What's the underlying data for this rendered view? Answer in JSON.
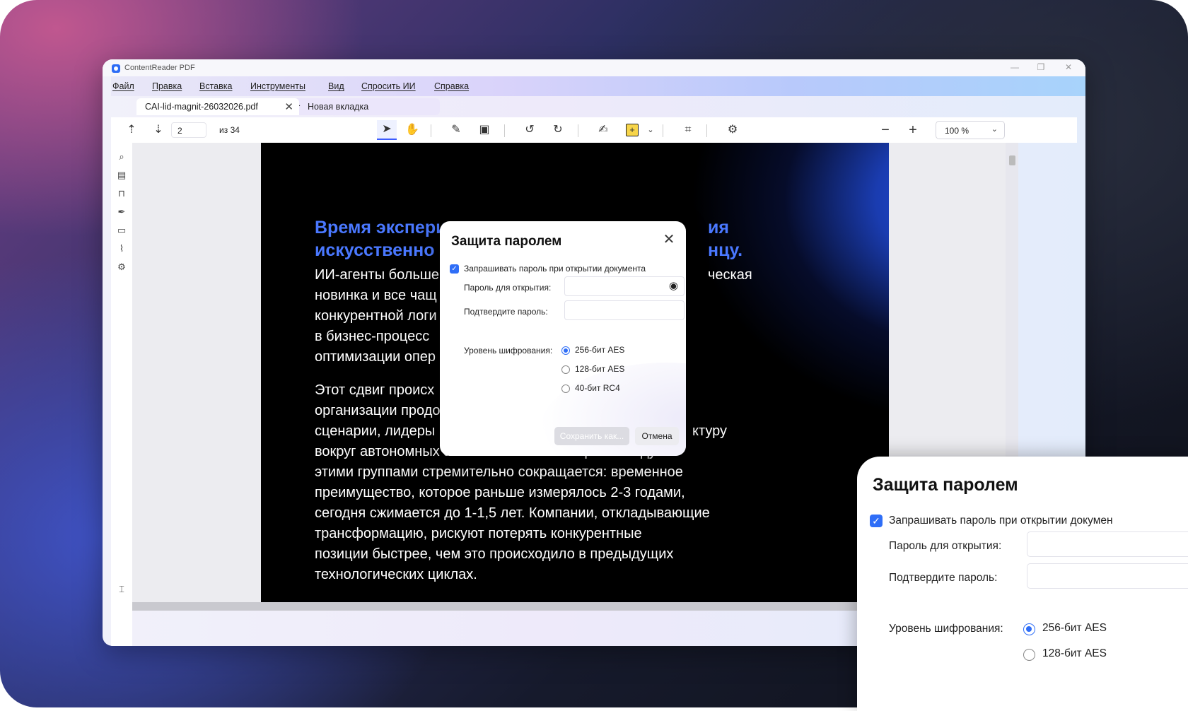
{
  "window": {
    "title": "ContentReader PDF",
    "minimize": "—",
    "restore": "❐",
    "close": "✕"
  },
  "menu": [
    "Файл",
    "Правка",
    "Вставка",
    "Инструменты",
    "Вид",
    "Спросить ИИ",
    "Справка"
  ],
  "tabs": {
    "active": "CAI-lid-magnit-26032026.pdf",
    "new_tab": "Новая вкладка"
  },
  "toolbar": {
    "page_current": "2",
    "page_of": "из",
    "page_total": "34",
    "zoom": "100 %"
  },
  "document": {
    "heading": "Время экспериментов с искусственным интеллектом подходит к концу.",
    "heading_visible": [
      "Время экспери",
      "искусственно",
      "ия",
      "нцу."
    ],
    "para1": [
      "ИИ-агенты больше",
      "новинка и все чащ",
      "конкурентной логи",
      "в бизнес-процесс",
      "оптимизации опер"
    ],
    "para1_right": [
      "ческая"
    ],
    "para2": [
      "Этот сдвиг происх",
      "организации продо",
      "сценарии, лидеры",
      "вокруг автономных агентных систем. Разрыв между",
      "этими группами стремительно сокращается: временное",
      "преимущество, которое раньше измерялось 2-3 годами,",
      "сегодня сжимается до 1-1,5 лет. Компании, откладывающие",
      "трансформацию, рискуют потерять конкурентные",
      "позиции быстрее, чем это происходило в предыдущих",
      "технологических циклах."
    ],
    "para2_right": [
      "ктуру"
    ]
  },
  "dialog": {
    "title": "Защита паролем",
    "require_password_label": "Запрашивать пароль при открытии документа",
    "require_password_checked": true,
    "open_password_label": "Пароль для открытия:",
    "confirm_password_label": "Подтвердите пароль:",
    "encryption_label": "Уровень шифрования:",
    "encryption_options": [
      "256-бит AES",
      "128-бит AES",
      "40-бит RC4"
    ],
    "encryption_selected": "256-бит AES",
    "save_button": "Сохранить как...",
    "cancel_button": "Отмена"
  },
  "callout": {
    "title": "Защита паролем",
    "require_password_label": "Запрашивать пароль при открытии докумен",
    "open_password_label": "Пароль для открытия:",
    "confirm_password_label": "Подтвердите пароль:",
    "encryption_label": "Уровень шифрования:",
    "encryption_options": [
      "256-бит AES",
      "128-бит AES"
    ]
  },
  "icons": {
    "toolbar": [
      "page-up-icon",
      "page-down-icon",
      "select-cursor-icon",
      "hand-pan-icon",
      "edit-icon",
      "clipboard-icon",
      "rotate-left-icon",
      "rotate-right-icon",
      "signature-icon",
      "add-text-box-icon",
      "crop-icon",
      "ai-robot-icon",
      "zoom-out-icon",
      "zoom-in-icon"
    ],
    "sidebar": [
      "search-icon",
      "page-thumbnails-icon",
      "bookmark-icon",
      "signature-icon",
      "comments-icon",
      "attachment-icon",
      "ai-robot-icon",
      "text-recognition-icon"
    ]
  },
  "colors": {
    "accent": "#2f6ef7",
    "heading_blue": "#4a78ff"
  }
}
